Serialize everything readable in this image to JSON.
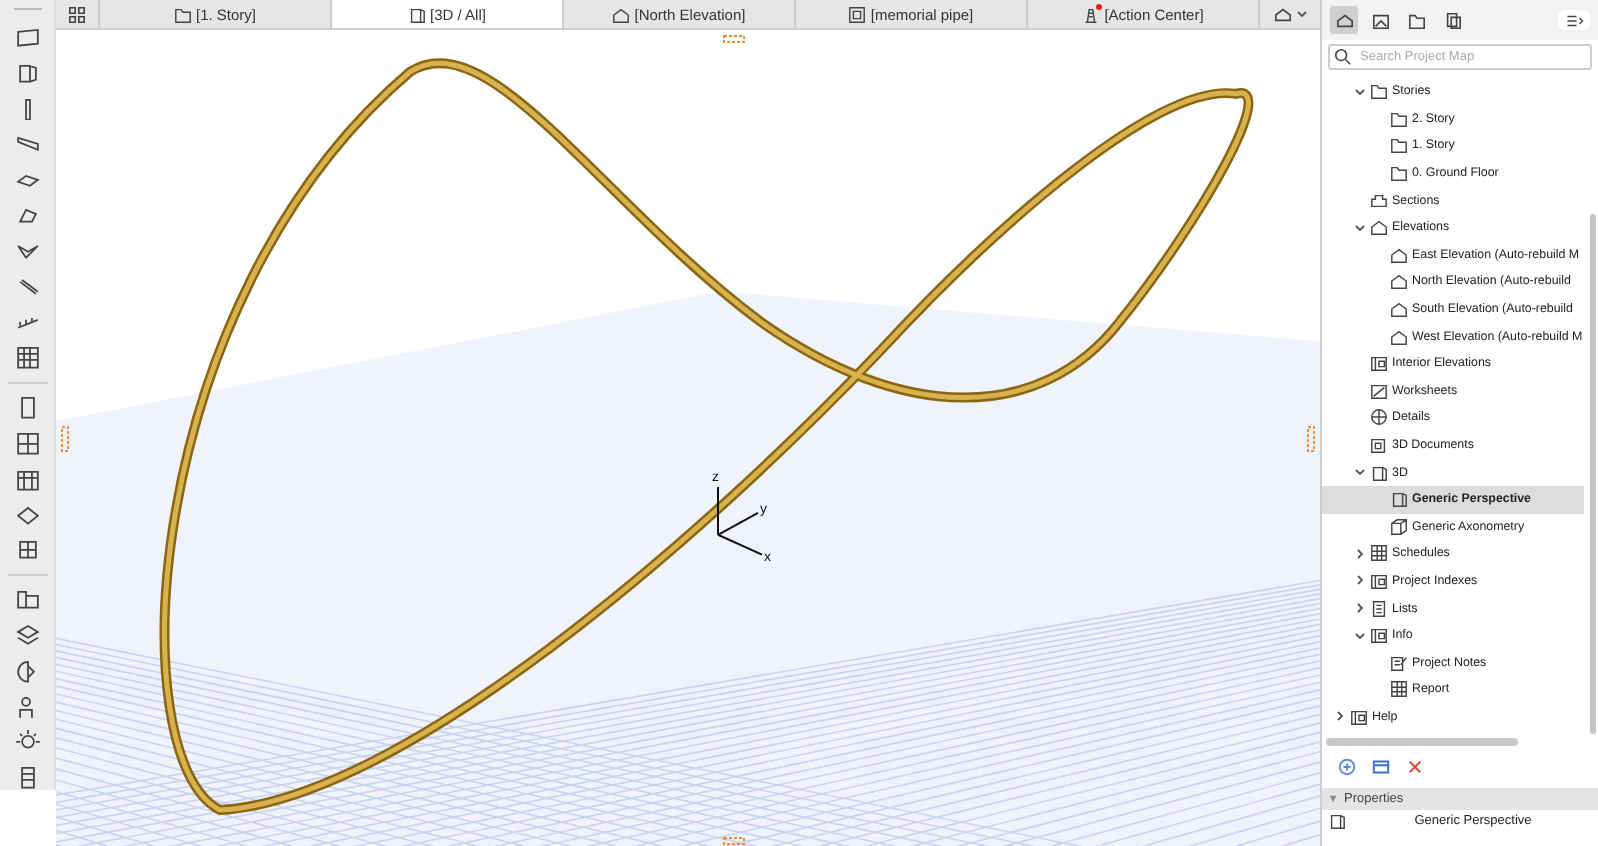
{
  "tabs": [
    {
      "label": "[1. Story]",
      "kind": "story",
      "selected": false,
      "alert": false
    },
    {
      "label": "[3D / All]",
      "kind": "box3d",
      "selected": true,
      "alert": false
    },
    {
      "label": "[North Elevation]",
      "kind": "elevation",
      "selected": false,
      "alert": false
    },
    {
      "label": "[memorial pipe]",
      "kind": "layout",
      "selected": false,
      "alert": false
    },
    {
      "label": "[Action Center]",
      "kind": "tower",
      "selected": false,
      "alert": true
    }
  ],
  "viewport": {
    "axes": {
      "z": "z",
      "y": "y",
      "x": "x"
    }
  },
  "map_tabs": [
    {
      "selected": true
    },
    {
      "selected": false
    },
    {
      "selected": false
    },
    {
      "selected": false
    }
  ],
  "search": {
    "placeholder": "Search Project Map"
  },
  "tree": {
    "items": [
      {
        "label": "Stories",
        "kind": "story",
        "expanded": true,
        "selected": false,
        "children": [
          {
            "label": "2. Story",
            "kind": "story",
            "selected": false
          },
          {
            "label": "1. Story",
            "kind": "story",
            "selected": false
          },
          {
            "label": "0. Ground Floor",
            "kind": "story",
            "selected": false
          }
        ]
      },
      {
        "label": "Sections",
        "kind": "section",
        "selected": false
      },
      {
        "label": "Elevations",
        "kind": "elevation",
        "expanded": true,
        "selected": false,
        "children": [
          {
            "label": "East Elevation (Auto-rebuild M",
            "kind": "elevation",
            "selected": false
          },
          {
            "label": "North Elevation (Auto-rebuild",
            "kind": "elevation",
            "selected": false
          },
          {
            "label": "South Elevation (Auto-rebuild",
            "kind": "elevation",
            "selected": false
          },
          {
            "label": "West Elevation (Auto-rebuild M",
            "kind": "elevation",
            "selected": false
          }
        ]
      },
      {
        "label": "Interior Elevations",
        "kind": "interior",
        "selected": false
      },
      {
        "label": "Worksheets",
        "kind": "sheet",
        "selected": false
      },
      {
        "label": "Details",
        "kind": "detail",
        "selected": false
      },
      {
        "label": "3D Documents",
        "kind": "doc3d",
        "selected": false
      },
      {
        "label": "3D",
        "kind": "box3d",
        "expanded": true,
        "selected": false,
        "children": [
          {
            "label": "Generic Perspective",
            "kind": "box3d",
            "selected": true
          },
          {
            "label": "Generic Axonometry",
            "kind": "cube",
            "selected": false
          }
        ]
      },
      {
        "label": "Schedules",
        "kind": "table",
        "expanded": false,
        "selected": false
      },
      {
        "label": "Project Indexes",
        "kind": "index",
        "expanded": false,
        "selected": false
      },
      {
        "label": "Lists",
        "kind": "list",
        "expanded": false,
        "selected": false
      },
      {
        "label": "Info",
        "kind": "index",
        "expanded": true,
        "selected": false,
        "children": [
          {
            "label": "Project Notes",
            "kind": "note",
            "selected": false
          },
          {
            "label": "Report",
            "kind": "table",
            "selected": false
          }
        ]
      }
    ]
  },
  "help": {
    "label": "Help",
    "kind": "index",
    "expanded": false,
    "selected": false
  },
  "properties": {
    "title": "Properties",
    "expanded": true,
    "value": "Generic Perspective"
  }
}
